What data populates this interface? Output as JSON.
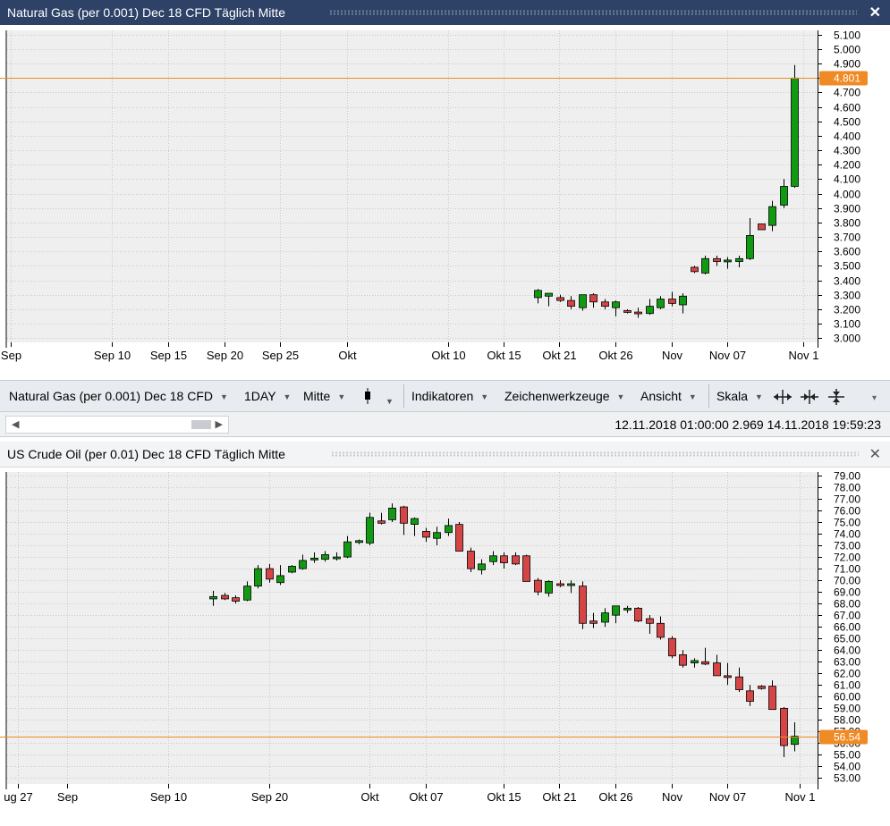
{
  "colors": {
    "title_active": "#2d4266",
    "up": "#129912",
    "down": "#d64545",
    "price_line": "#f08a24",
    "chart_bg": "#efefef",
    "grid": "#c8c8c8"
  },
  "window1": {
    "title": "Natural Gas (per 0.001) Dec 18 CFD Täglich Mitte",
    "close_icon": "✕"
  },
  "window2": {
    "title": "US Crude Oil (per 0.01) Dec 18 CFD Täglich Mitte",
    "close_icon": "✕"
  },
  "toolbar": {
    "instrument": "Natural Gas (per 0.001) Dec 18 CFD",
    "interval": "1DAY",
    "price_type": "Mitte",
    "chart_type_icon": "candlestick-icon",
    "indicators": "Indikatoren",
    "drawing_tools": "Zeichenwerkzeuge",
    "view": "Ansicht",
    "scale": "Skala",
    "more_icon": "▾"
  },
  "statusbar": {
    "text": "12.11.2018 01:00:00 2.969   14.11.2018 19:59:23"
  },
  "chart_data": [
    {
      "type": "candlestick",
      "ylim": [
        2.97,
        5.13
      ],
      "yticks": [
        "5.100",
        "5.000",
        "4.900",
        "4.800",
        "4.700",
        "4.600",
        "4.500",
        "4.400",
        "4.300",
        "4.200",
        "4.100",
        "4.000",
        "3.900",
        "3.800",
        "3.700",
        "3.600",
        "3.500",
        "3.400",
        "3.300",
        "3.200",
        "3.100",
        "3.000"
      ],
      "xticks": [
        "Sep",
        "Sep 10",
        "Sep 15",
        "Sep 20",
        "Sep 25",
        "Okt",
        "Okt 10",
        "Okt 15",
        "Okt 21",
        "Okt 26",
        "Nov",
        "Nov 07",
        "Nov 1"
      ],
      "current_price": "4.801",
      "current_value": 4.801,
      "candles": [
        {
          "o": 3.28,
          "h": 3.34,
          "l": 3.24,
          "c": 3.33
        },
        {
          "o": 3.29,
          "h": 3.31,
          "l": 3.22,
          "c": 3.31
        },
        {
          "o": 3.28,
          "h": 3.3,
          "l": 3.25,
          "c": 3.26
        },
        {
          "o": 3.26,
          "h": 3.29,
          "l": 3.2,
          "c": 3.22
        },
        {
          "o": 3.21,
          "h": 3.3,
          "l": 3.19,
          "c": 3.3
        },
        {
          "o": 3.3,
          "h": 3.31,
          "l": 3.21,
          "c": 3.25
        },
        {
          "o": 3.25,
          "h": 3.27,
          "l": 3.2,
          "c": 3.22
        },
        {
          "o": 3.21,
          "h": 3.26,
          "l": 3.15,
          "c": 3.25
        },
        {
          "o": 3.19,
          "h": 3.2,
          "l": 3.17,
          "c": 3.18
        },
        {
          "o": 3.18,
          "h": 3.21,
          "l": 3.14,
          "c": 3.17
        },
        {
          "o": 3.17,
          "h": 3.27,
          "l": 3.16,
          "c": 3.22
        },
        {
          "o": 3.21,
          "h": 3.29,
          "l": 3.2,
          "c": 3.27
        },
        {
          "o": 3.27,
          "h": 3.32,
          "l": 3.22,
          "c": 3.24
        },
        {
          "o": 3.23,
          "h": 3.31,
          "l": 3.17,
          "c": 3.29
        },
        {
          "o": 3.49,
          "h": 3.5,
          "l": 3.45,
          "c": 3.46
        },
        {
          "o": 3.45,
          "h": 3.57,
          "l": 3.44,
          "c": 3.55
        },
        {
          "o": 3.55,
          "h": 3.57,
          "l": 3.5,
          "c": 3.53
        },
        {
          "o": 3.53,
          "h": 3.56,
          "l": 3.48,
          "c": 3.54
        },
        {
          "o": 3.53,
          "h": 3.57,
          "l": 3.49,
          "c": 3.55
        },
        {
          "o": 3.55,
          "h": 3.83,
          "l": 3.54,
          "c": 3.71
        },
        {
          "o": 3.79,
          "h": 3.79,
          "l": 3.75,
          "c": 3.75
        },
        {
          "o": 3.78,
          "h": 3.95,
          "l": 3.74,
          "c": 3.91
        },
        {
          "o": 3.92,
          "h": 4.1,
          "l": 3.9,
          "c": 4.05
        },
        {
          "o": 4.05,
          "h": 4.89,
          "l": 4.04,
          "c": 4.8
        }
      ]
    },
    {
      "type": "candlestick",
      "ylim": [
        52.5,
        79.3
      ],
      "yticks": [
        "79.00",
        "78.00",
        "77.00",
        "76.00",
        "75.00",
        "74.00",
        "73.00",
        "72.00",
        "71.00",
        "70.00",
        "69.00",
        "68.00",
        "67.00",
        "66.00",
        "65.00",
        "64.00",
        "63.00",
        "62.00",
        "61.00",
        "60.00",
        "59.00",
        "58.00",
        "57.00",
        "56.00",
        "55.00",
        "54.00",
        "53.00"
      ],
      "xticks": [
        "ug 27",
        "Sep",
        "Sep 10",
        "Sep 20",
        "Okt",
        "Okt 07",
        "Okt 15",
        "Okt 21",
        "Okt 26",
        "Nov",
        "Nov 07",
        "Nov 1"
      ],
      "current_price": "56.54",
      "current_value": 56.54,
      "candles": [
        {
          "o": 68.4,
          "h": 69.1,
          "l": 67.8,
          "c": 68.6
        },
        {
          "o": 68.7,
          "h": 68.9,
          "l": 68.3,
          "c": 68.4
        },
        {
          "o": 68.5,
          "h": 68.7,
          "l": 68.0,
          "c": 68.2
        },
        {
          "o": 68.3,
          "h": 69.9,
          "l": 68.2,
          "c": 69.5
        },
        {
          "o": 69.5,
          "h": 71.3,
          "l": 69.3,
          "c": 71.0
        },
        {
          "o": 71.0,
          "h": 71.4,
          "l": 69.8,
          "c": 70.1
        },
        {
          "o": 69.8,
          "h": 71.3,
          "l": 69.6,
          "c": 70.4
        },
        {
          "o": 70.7,
          "h": 71.3,
          "l": 70.6,
          "c": 71.2
        },
        {
          "o": 71.0,
          "h": 72.2,
          "l": 70.9,
          "c": 71.7
        },
        {
          "o": 71.8,
          "h": 72.4,
          "l": 71.5,
          "c": 71.9
        },
        {
          "o": 71.8,
          "h": 72.5,
          "l": 71.6,
          "c": 72.2
        },
        {
          "o": 71.9,
          "h": 72.4,
          "l": 71.7,
          "c": 72.0
        },
        {
          "o": 72.0,
          "h": 73.8,
          "l": 71.9,
          "c": 73.3
        },
        {
          "o": 73.3,
          "h": 73.5,
          "l": 73.1,
          "c": 73.4
        },
        {
          "o": 73.2,
          "h": 75.8,
          "l": 73.0,
          "c": 75.4
        },
        {
          "o": 75.1,
          "h": 75.8,
          "l": 74.8,
          "c": 74.9
        },
        {
          "o": 75.2,
          "h": 76.6,
          "l": 75.0,
          "c": 76.2
        },
        {
          "o": 76.3,
          "h": 76.4,
          "l": 73.9,
          "c": 74.9
        },
        {
          "o": 74.8,
          "h": 75.4,
          "l": 73.8,
          "c": 75.3
        },
        {
          "o": 74.2,
          "h": 74.5,
          "l": 73.3,
          "c": 73.7
        },
        {
          "o": 73.6,
          "h": 74.6,
          "l": 73.0,
          "c": 74.1
        },
        {
          "o": 74.1,
          "h": 75.3,
          "l": 73.8,
          "c": 74.7
        },
        {
          "o": 74.8,
          "h": 75.0,
          "l": 72.6,
          "c": 72.5
        },
        {
          "o": 72.5,
          "h": 72.8,
          "l": 70.7,
          "c": 71.0
        },
        {
          "o": 70.9,
          "h": 71.8,
          "l": 70.5,
          "c": 71.4
        },
        {
          "o": 71.6,
          "h": 72.5,
          "l": 71.3,
          "c": 72.1
        },
        {
          "o": 72.1,
          "h": 72.4,
          "l": 71.0,
          "c": 71.5
        },
        {
          "o": 72.1,
          "h": 72.4,
          "l": 71.3,
          "c": 71.4
        },
        {
          "o": 72.1,
          "h": 72.2,
          "l": 69.9,
          "c": 69.9
        },
        {
          "o": 70.0,
          "h": 70.2,
          "l": 68.7,
          "c": 69.0
        },
        {
          "o": 68.9,
          "h": 70.0,
          "l": 68.6,
          "c": 69.9
        },
        {
          "o": 69.7,
          "h": 70.0,
          "l": 69.4,
          "c": 69.6
        },
        {
          "o": 69.6,
          "h": 70.0,
          "l": 68.9,
          "c": 69.7
        },
        {
          "o": 69.5,
          "h": 69.9,
          "l": 65.8,
          "c": 66.3
        },
        {
          "o": 66.5,
          "h": 67.2,
          "l": 65.9,
          "c": 66.3
        },
        {
          "o": 66.4,
          "h": 67.6,
          "l": 66.0,
          "c": 67.2
        },
        {
          "o": 67.0,
          "h": 67.7,
          "l": 66.3,
          "c": 67.8
        },
        {
          "o": 67.5,
          "h": 67.8,
          "l": 67.2,
          "c": 67.6
        },
        {
          "o": 67.6,
          "h": 67.7,
          "l": 66.4,
          "c": 66.5
        },
        {
          "o": 66.7,
          "h": 67.0,
          "l": 65.4,
          "c": 66.3
        },
        {
          "o": 66.3,
          "h": 66.9,
          "l": 64.9,
          "c": 65.1
        },
        {
          "o": 65.0,
          "h": 65.2,
          "l": 63.3,
          "c": 63.5
        },
        {
          "o": 63.6,
          "h": 64.0,
          "l": 62.5,
          "c": 62.7
        },
        {
          "o": 62.9,
          "h": 63.3,
          "l": 62.5,
          "c": 63.1
        },
        {
          "o": 63.0,
          "h": 64.2,
          "l": 62.7,
          "c": 62.8
        },
        {
          "o": 62.9,
          "h": 63.6,
          "l": 61.8,
          "c": 61.8
        },
        {
          "o": 61.8,
          "h": 62.9,
          "l": 61.0,
          "c": 61.7
        },
        {
          "o": 61.7,
          "h": 62.5,
          "l": 60.4,
          "c": 60.6
        },
        {
          "o": 60.5,
          "h": 61.0,
          "l": 59.2,
          "c": 59.6
        },
        {
          "o": 60.9,
          "h": 61.0,
          "l": 60.6,
          "c": 60.7
        },
        {
          "o": 60.9,
          "h": 61.4,
          "l": 58.9,
          "c": 58.9
        },
        {
          "o": 59.0,
          "h": 59.1,
          "l": 54.8,
          "c": 55.8
        },
        {
          "o": 55.9,
          "h": 57.8,
          "l": 55.3,
          "c": 56.6
        }
      ]
    }
  ]
}
